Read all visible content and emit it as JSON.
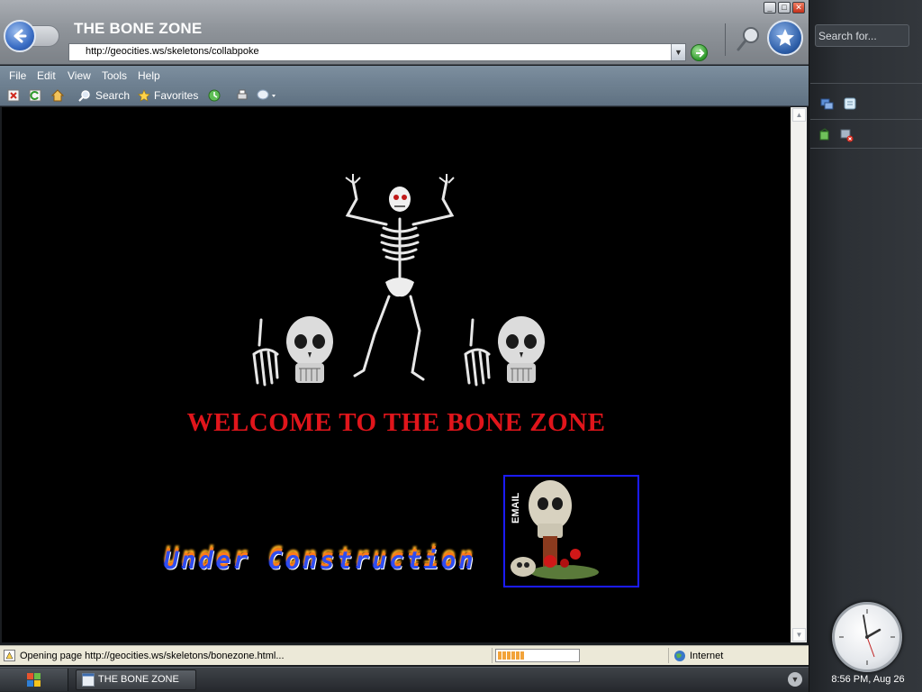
{
  "window": {
    "title": "THE BONE ZONE",
    "address": "http://geocities.ws/skeletons/collabpoke"
  },
  "menu": [
    "File",
    "Edit",
    "View",
    "Tools",
    "Help"
  ],
  "toolbar": {
    "search_label": "Search",
    "favorites_label": "Favorites"
  },
  "page": {
    "heading": "WELCOME TO THE BONE ZONE",
    "under_construction": "Under Construction",
    "email_label": "EMAIL"
  },
  "status": {
    "text": "Opening page http://geocities.ws/skeletons/bonezone.html...",
    "progress_fraction": 0.33,
    "zone": "Internet"
  },
  "taskbar": {
    "task_label": "THE BONE ZONE"
  },
  "sidebar": {
    "search_placeholder": "Search for...",
    "clock_text": "8:56 PM, Aug 26"
  },
  "colors": {
    "heading_red": "#e0151b",
    "email_border": "#1b1bff"
  }
}
